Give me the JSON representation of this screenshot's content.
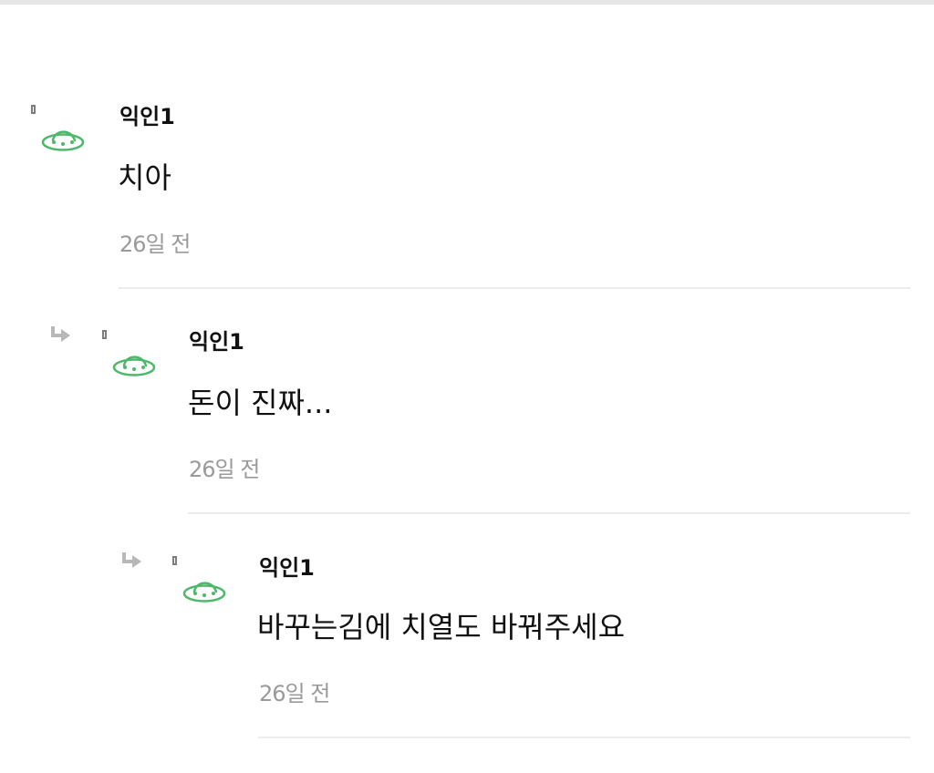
{
  "comments": [
    {
      "author": "익인1",
      "text": "치아",
      "time": "26일 전",
      "avatar_icon": "ufo-avatar-icon",
      "is_reply": false
    },
    {
      "author": "익인1",
      "text": "돈이 진짜...",
      "time": "26일 전",
      "avatar_icon": "ufo-avatar-icon",
      "reply_icon": "reply-arrow-icon",
      "is_reply": true
    },
    {
      "author": "익인1",
      "text": "바꾸는김에 치열도 바꿔주세요",
      "time": "26일 전",
      "avatar_icon": "ufo-avatar-icon",
      "reply_icon": "reply-arrow-icon",
      "is_reply": true
    }
  ],
  "colors": {
    "avatar": "#4db86a",
    "time": "#9a9a9a",
    "divider": "#ececec",
    "reply_arrow": "#b8b8b8"
  }
}
